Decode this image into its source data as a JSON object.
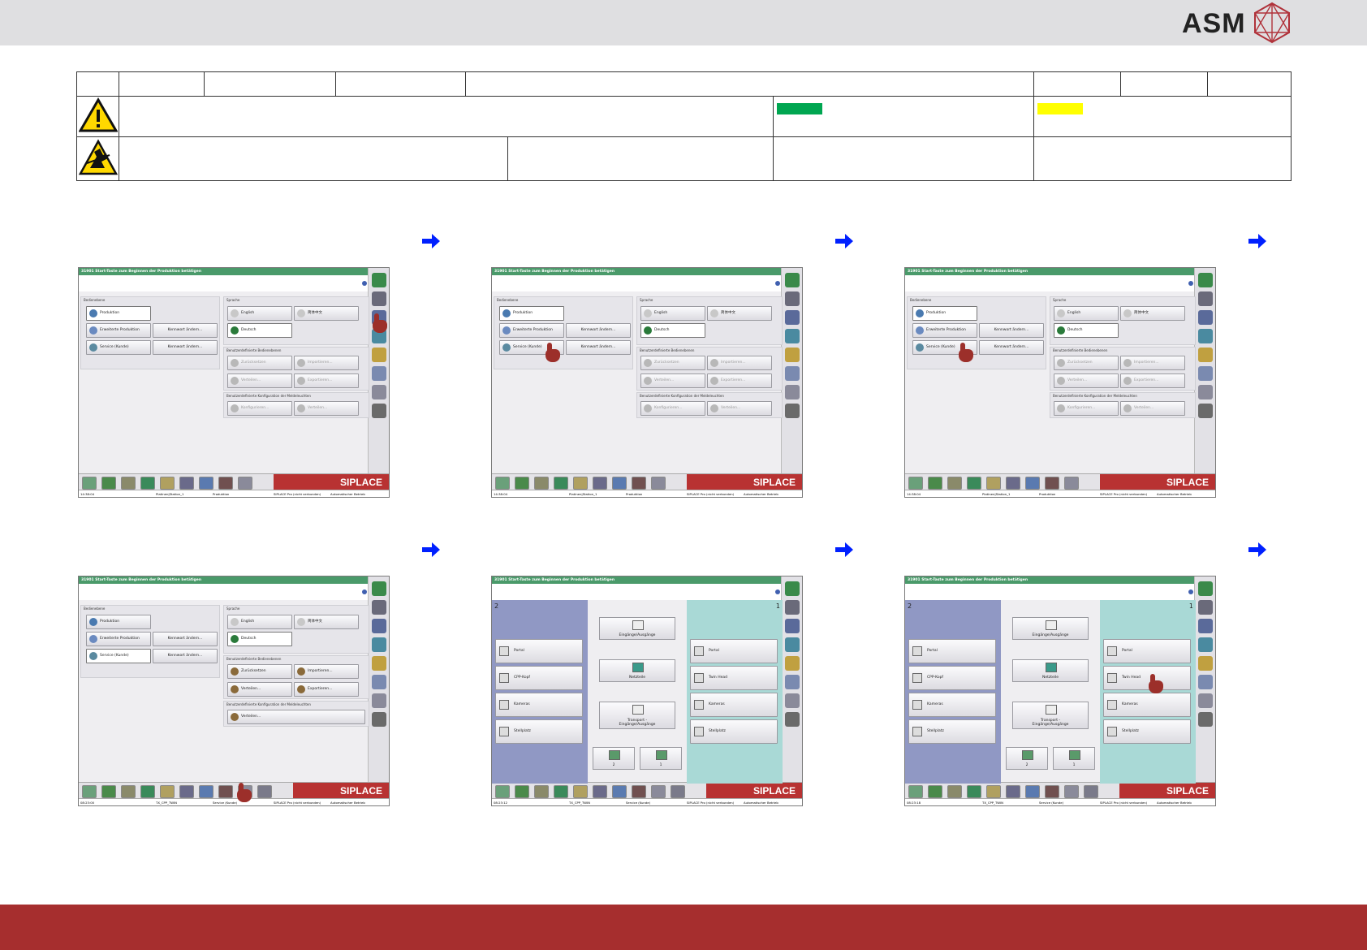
{
  "header": {
    "brand": "ASM"
  },
  "shots": [
    {
      "id": "s1",
      "title": "31901 Start-Taste zum Beginnen der Produktion betätigen",
      "status": [
        "14:38:04",
        "Platinen|Station_1",
        "Produktion",
        "SIPLACE Pro (nicht verbunden)",
        "Automatischer Betrieb"
      ],
      "bedienebene": "Bedienebene",
      "sprache": "Sprache",
      "levels": [
        "Produktion",
        "Erweiterte Produktion",
        "Service (Kunde)"
      ],
      "kennwort": "Kennwort ändern...",
      "langs": [
        "English",
        "简体中文",
        "Deutsch"
      ],
      "bed_title": "Benutzerdefinierte Bedienebenen",
      "bed_btns": [
        "Zurücksetzen",
        "Importieren...",
        "Verteilen...",
        "Exportieren..."
      ],
      "melde_title": "Benutzerdefinierte Konfiguration der Meldeleuchten",
      "melde_btns": [
        "Konfigurieren...",
        "Verteilen..."
      ],
      "siplace": "SIPLACE"
    },
    {
      "id": "s4",
      "title": "31901 Start-Taste zum Beginnen der Produktion betätigen",
      "status": [
        "08:23:00",
        "TX_CPP_TWIN",
        "Service (Kunde)",
        "SIPLACE Pro (nicht verbunden)",
        "Automatischer Betrieb"
      ],
      "bed_btns": [
        "Zurücksetzen",
        "Importieren...",
        "Verteilen...",
        "Exportieren..."
      ],
      "melde_btns": [
        "Verteilen..."
      ]
    },
    {
      "id": "s5",
      "title": "31901 Start-Taste zum Beginnen der Produktion betätigen",
      "status": [
        "08:23:12",
        "TX_CPP_TWIN",
        "Service (Kunde)",
        "SIPLACE Pro (nicht verbunden)",
        "Automatischer Betrieb"
      ],
      "left_num": "2",
      "right_num": "1",
      "left_btns": [
        "Portal",
        "CPP-Kopf",
        "Kameras",
        "Stellplatz"
      ],
      "right_btns": [
        "Portal",
        "Twin Head",
        "Kameras",
        "Stellplatz"
      ],
      "center_btns": [
        "Eingänge/Ausgänge",
        "Netzteile",
        "Transport -\nEingänge/Ausgänge"
      ],
      "small_btns": [
        "2",
        "1"
      ]
    },
    {
      "id": "s6",
      "status": [
        "08:23:18",
        "TX_CPP_TWIN",
        "Service (Kunde)",
        "SIPLACE Pro (nicht verbunden)",
        "Automatischer Betrieb"
      ]
    }
  ],
  "colors": {
    "accent_red": "#a62e2e",
    "title_green": "#4a9a6a",
    "siplace_red": "#b83232",
    "mark_green": "#00a651",
    "mark_yellow": "#ffff00",
    "arrow_blue": "#0020ff"
  }
}
